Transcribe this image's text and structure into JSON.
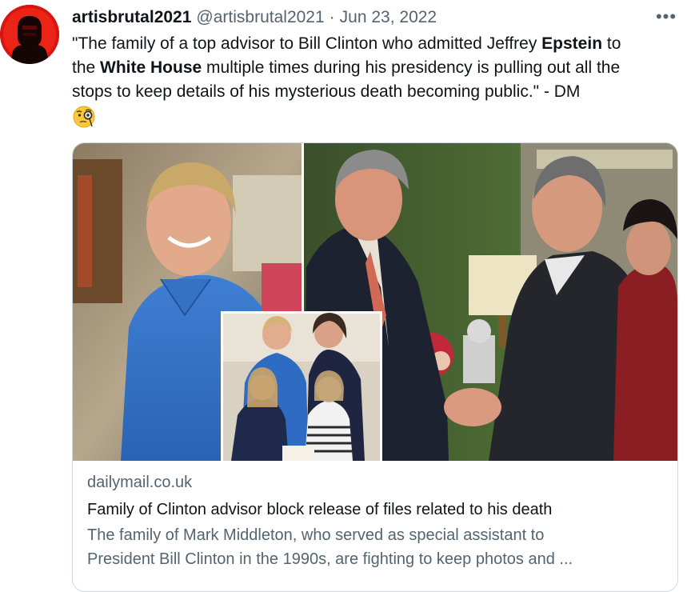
{
  "tweet": {
    "author": {
      "display_name": "artisbrutal2021",
      "handle": "@artisbrutal2021",
      "avatar_icon": "red-silhouette-avatar"
    },
    "separator": "·",
    "date": "Jun 23, 2022",
    "more_icon": "ellipsis-icon",
    "more_label": "•••",
    "text": {
      "line1_a": "\"The family of a top advisor to Bill Clinton who admitted Jeffrey ",
      "line1_b": "Epstein",
      "line1_c": " to",
      "line2_a": "the ",
      "line2_b": "White House",
      "line2_c": " multiple times during his presidency is pulling out all the",
      "line3": "stops to keep details of his mysterious death becoming public.\" - DM"
    },
    "emoji": "face-with-monocle-icon"
  },
  "link_card": {
    "domain": "dailymail.co.uk",
    "title": "Family of Clinton advisor block release of files related to his death",
    "description_line1": "The family of Mark Middleton, who served as special assistant to",
    "description_line2": "President Bill Clinton in the 1990s, are fighting to keep photos and ..."
  },
  "colors": {
    "text_primary": "#0f1419",
    "text_secondary": "#536471",
    "border": "#cfd9de",
    "avatar_red": "#d0140f"
  }
}
